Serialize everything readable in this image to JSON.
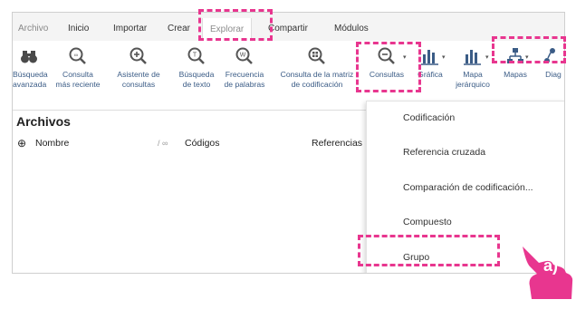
{
  "menubar": {
    "items": [
      "Archivo",
      "Inicio",
      "Importar",
      "Crear",
      "Explorar",
      "Compartir",
      "Módulos"
    ],
    "active": "Explorar"
  },
  "ribbon": {
    "buttons": [
      {
        "icon": "binoculars-icon",
        "line1": "Búsqueda",
        "line2": "avanzada"
      },
      {
        "icon": "query-icon",
        "line1": "Consulta",
        "line2": "más reciente"
      },
      {
        "icon": "query-wizard-icon",
        "line1": "Asistente de",
        "line2": "consultas"
      },
      {
        "icon": "text-search-icon",
        "line1": "Búsqueda",
        "line2": "de texto"
      },
      {
        "icon": "word-frequency-icon",
        "line1": "Frecuencia",
        "line2": "de palabras"
      },
      {
        "icon": "matrix-query-icon",
        "line1": "Consulta de la matriz",
        "line2": "de codificación"
      },
      {
        "icon": "queries-icon",
        "line1": "Consultas",
        "line2": ""
      },
      {
        "icon": "chart-icon",
        "line1": "Gráfica",
        "line2": ""
      },
      {
        "icon": "hierarchy-chart-icon",
        "line1": "Mapa",
        "line2": "jerárquico"
      },
      {
        "icon": "maps-icon",
        "line1": "Mapas",
        "line2": ""
      },
      {
        "icon": "diagram-icon",
        "line1": "Diag",
        "line2": ""
      }
    ]
  },
  "content": {
    "title": "Archivos",
    "columns": {
      "name": "Nombre",
      "codes": "Códigos",
      "refs": "Referencias"
    }
  },
  "dropdown": {
    "items": [
      "Codificación",
      "Referencia cruzada",
      "Comparación de codificación...",
      "Compuesto",
      "Grupo"
    ]
  },
  "callout": {
    "label": "a)"
  },
  "colors": {
    "highlight": "#e8368f",
    "ribbon_text": "#3b5c86"
  }
}
